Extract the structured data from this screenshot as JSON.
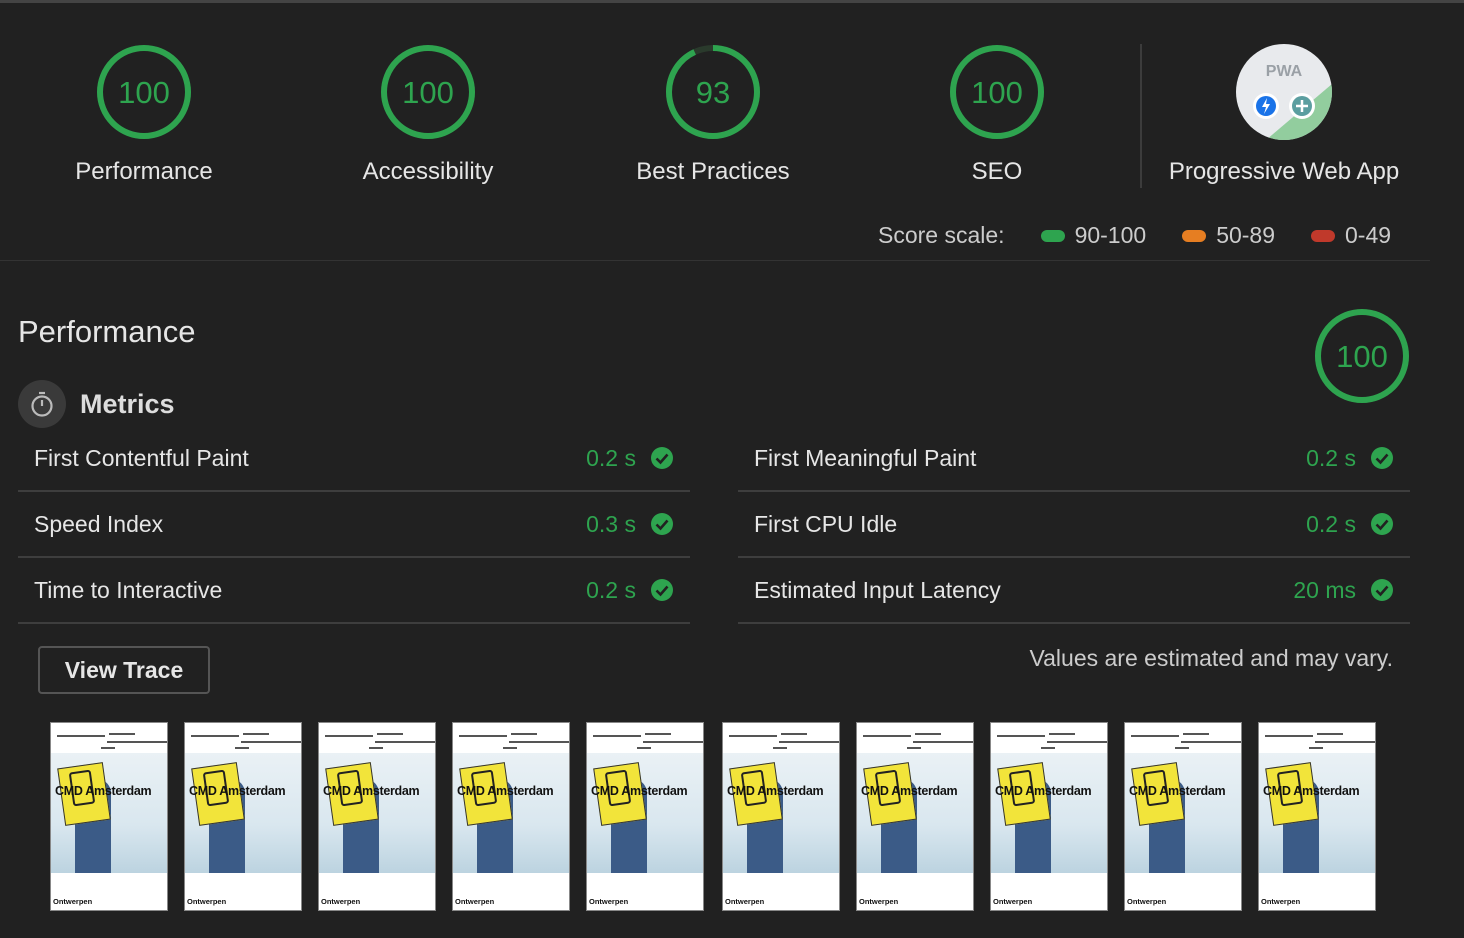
{
  "categories": [
    {
      "label": "Performance",
      "score": 100,
      "color": "#2ea44f"
    },
    {
      "label": "Accessibility",
      "score": 100,
      "color": "#2ea44f"
    },
    {
      "label": "Best Practices",
      "score": 93,
      "color": "#2ea44f"
    },
    {
      "label": "SEO",
      "score": 100,
      "color": "#2ea44f"
    }
  ],
  "pwa": {
    "label": "Progressive Web App",
    "badge_text": "PWA"
  },
  "score_scale": {
    "label": "Score scale:",
    "ranges": [
      {
        "text": "90-100",
        "color": "#2ea44f"
      },
      {
        "text": "50-89",
        "color": "#e67e22"
      },
      {
        "text": "0-49",
        "color": "#c0392b"
      }
    ]
  },
  "performance": {
    "title": "Performance",
    "score": 100,
    "metrics_title": "Metrics",
    "metrics_left": [
      {
        "name": "First Contentful Paint",
        "value": "0.2 s"
      },
      {
        "name": "Speed Index",
        "value": "0.3 s"
      },
      {
        "name": "Time to Interactive",
        "value": "0.2 s"
      }
    ],
    "metrics_right": [
      {
        "name": "First Meaningful Paint",
        "value": "0.2 s"
      },
      {
        "name": "First CPU Idle",
        "value": "0.2 s"
      },
      {
        "name": "Estimated Input Latency",
        "value": "20 ms"
      }
    ],
    "view_trace_label": "View Trace",
    "note": "Values are estimated and may vary."
  },
  "filmstrip": {
    "frame_count": 10,
    "frame_title": "CMD Amsterdam",
    "frame_footer": "Ontwerpen"
  }
}
